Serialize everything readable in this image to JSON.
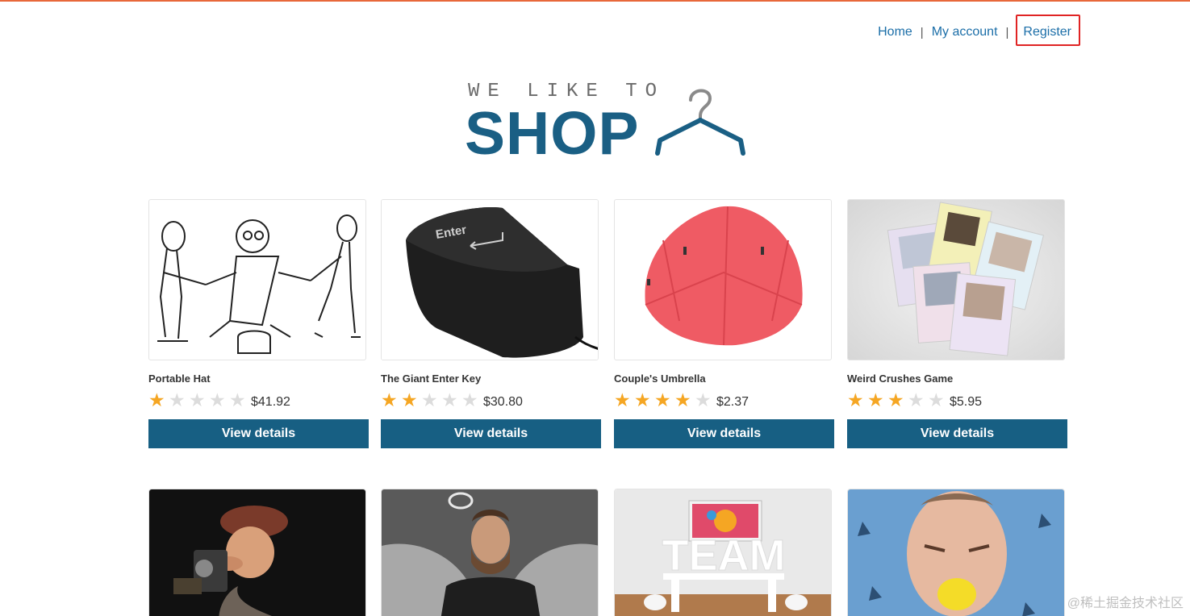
{
  "nav": {
    "home": "Home",
    "account": "My account",
    "register": "Register",
    "separator": "|"
  },
  "logo": {
    "tagline": "WE LIKE TO",
    "word": "SHOP",
    "icon": "hanger-icon"
  },
  "products_row1": [
    {
      "name": "Portable Hat",
      "rating": 1,
      "price": "$41.92",
      "button": "View details",
      "image": "drawing-people-tug"
    },
    {
      "name": "The Giant Enter Key",
      "rating": 2,
      "price": "$30.80",
      "button": "View details",
      "image": "giant-enter-key"
    },
    {
      "name": "Couple's Umbrella",
      "rating": 4,
      "price": "$2.37",
      "button": "View details",
      "image": "red-double-umbrella"
    },
    {
      "name": "Weird Crushes Game",
      "rating": 3,
      "price": "$5.95",
      "button": "View details",
      "image": "cards-faces"
    }
  ],
  "products_row2": [
    {
      "image": "photographer-figurine"
    },
    {
      "image": "angel-man"
    },
    {
      "image": "team-room",
      "text": "TEAM"
    },
    {
      "image": "lemon-face"
    }
  ],
  "watermark": "@稀土掘金技术社区",
  "colors": {
    "accent": "#175f83",
    "link": "#1b6ea8",
    "star_on": "#f5a623",
    "star_off": "#dcdcdc",
    "highlight": "#e02424"
  }
}
